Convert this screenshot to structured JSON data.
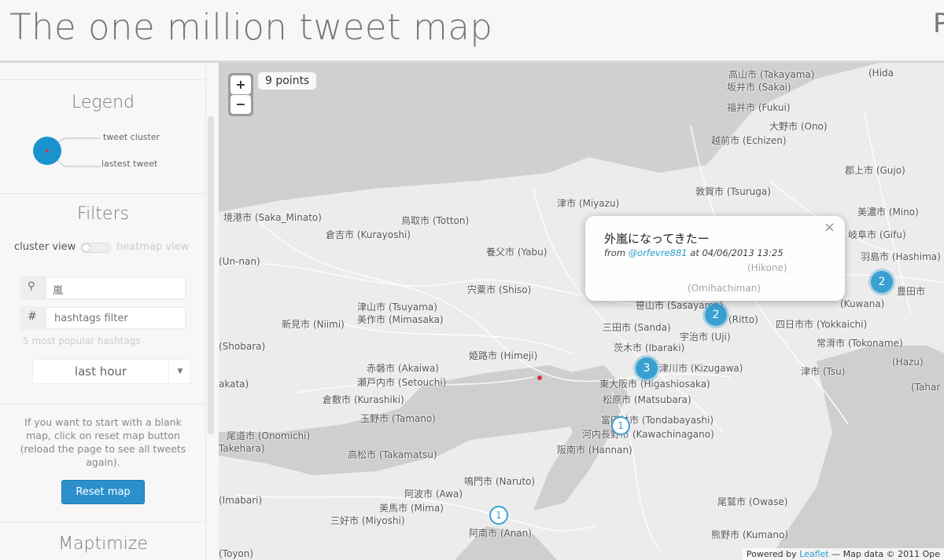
{
  "header": {
    "title": "The one million tweet map",
    "cut_text": "P"
  },
  "legend": {
    "title": "Legend",
    "cluster_label": "tweet cluster",
    "latest_label": "lastest tweet",
    "colors": {
      "cluster": "#1a94cf",
      "latest": "#d9304f"
    }
  },
  "filters": {
    "title": "Filters",
    "cluster_view": "cluster view",
    "heatmap_view": "heatmap view",
    "search_value": "嵐",
    "hashtag_placeholder": "hashtags filter",
    "popular_label": "5 most popular hashtags",
    "time_select": "last hour"
  },
  "reset": {
    "text": "If you want to start with a blank map, click on reset map button (reload the page to see all tweets again).",
    "button": "Reset map"
  },
  "maptimize": {
    "title": "Maptimize"
  },
  "map": {
    "points_label": "9 points",
    "zoom_in": "+",
    "zoom_out": "−",
    "popup": {
      "text": "外嵐になってきたー",
      "from": "from",
      "user": "@orfevre881",
      "at": "at 04/06/2013 13:25",
      "close": "×"
    },
    "clusters": [
      "2",
      "3",
      "1",
      "1",
      "2"
    ],
    "attribution": {
      "prefix": "Powered by",
      "link": "Leaflet",
      "suffix": "— Map data © 2011 Ope"
    },
    "labels": [
      "坂井市 (Sakai)",
      "福井市 (Fukui)",
      "大野市 (Ono)",
      "越前市 (Echizen)",
      "郡上市 (Gujo)",
      "敦賀市 (Tsuruga)",
      "美濃市 (Mino)",
      "岐阜市 (Gifu)",
      "津市 (Miyazu)",
      "境港市 (Saka_Minato)",
      "鳥取市 (Totton)",
      "倉吉市 (Kurayoshi)",
      "養父市 (Yabu)",
      "(Un-nan)",
      "宍粟市 (Shiso)",
      "津山市 (Tsuyama)",
      "美作市 (Mimasaka)",
      "新見市 (Niimi)",
      "(Shobara)",
      "三田市 (Sanda)",
      "茨木市 (Ibaraki)",
      "姫路市 (Himeji)",
      "(Ritto)",
      "宇治市 (Uji)",
      "四日市市 (Yokkaichi)",
      "常滑市 (Tokoname)",
      "赤磐市 (Akaiwa)",
      "瀬戸内市 (Setouchi)",
      "津川市 (Kizugawa)",
      "東大阪市 (Higashiosaka)",
      "松原市 (Matsubara)",
      "倉敷市 (Kurashiki)",
      "玉野市 (Tamano)",
      "富田林市 (Tondabayashi)",
      "河内長野市 (Kawachinagano)",
      "尾道市 (Onomichi)",
      "高松市 (Takamatsu)",
      "阪南市 (Hannan)",
      "鳴門市 (Naruto)",
      "阿波市 (Awa)",
      "美馬市 (Mima)",
      "三好市 (Miyoshi)",
      "阿南市 (Anan)",
      "尾鷲市 (Owase)",
      "熊野市 (Kumano)",
      "(Imabari)",
      "(Toyon)",
      "津市 (Tsu)",
      "(Kuwana)",
      "豊田市",
      "(Hazu)",
      "(Tahar",
      "akata)",
      "Takehara)",
      "高山市 (Takayama)",
      "(Hida",
      "羽島市 (Hashima)",
      "(Hikone)",
      "(Omihachiman)",
      "笹山市 (Sasayama)"
    ]
  }
}
